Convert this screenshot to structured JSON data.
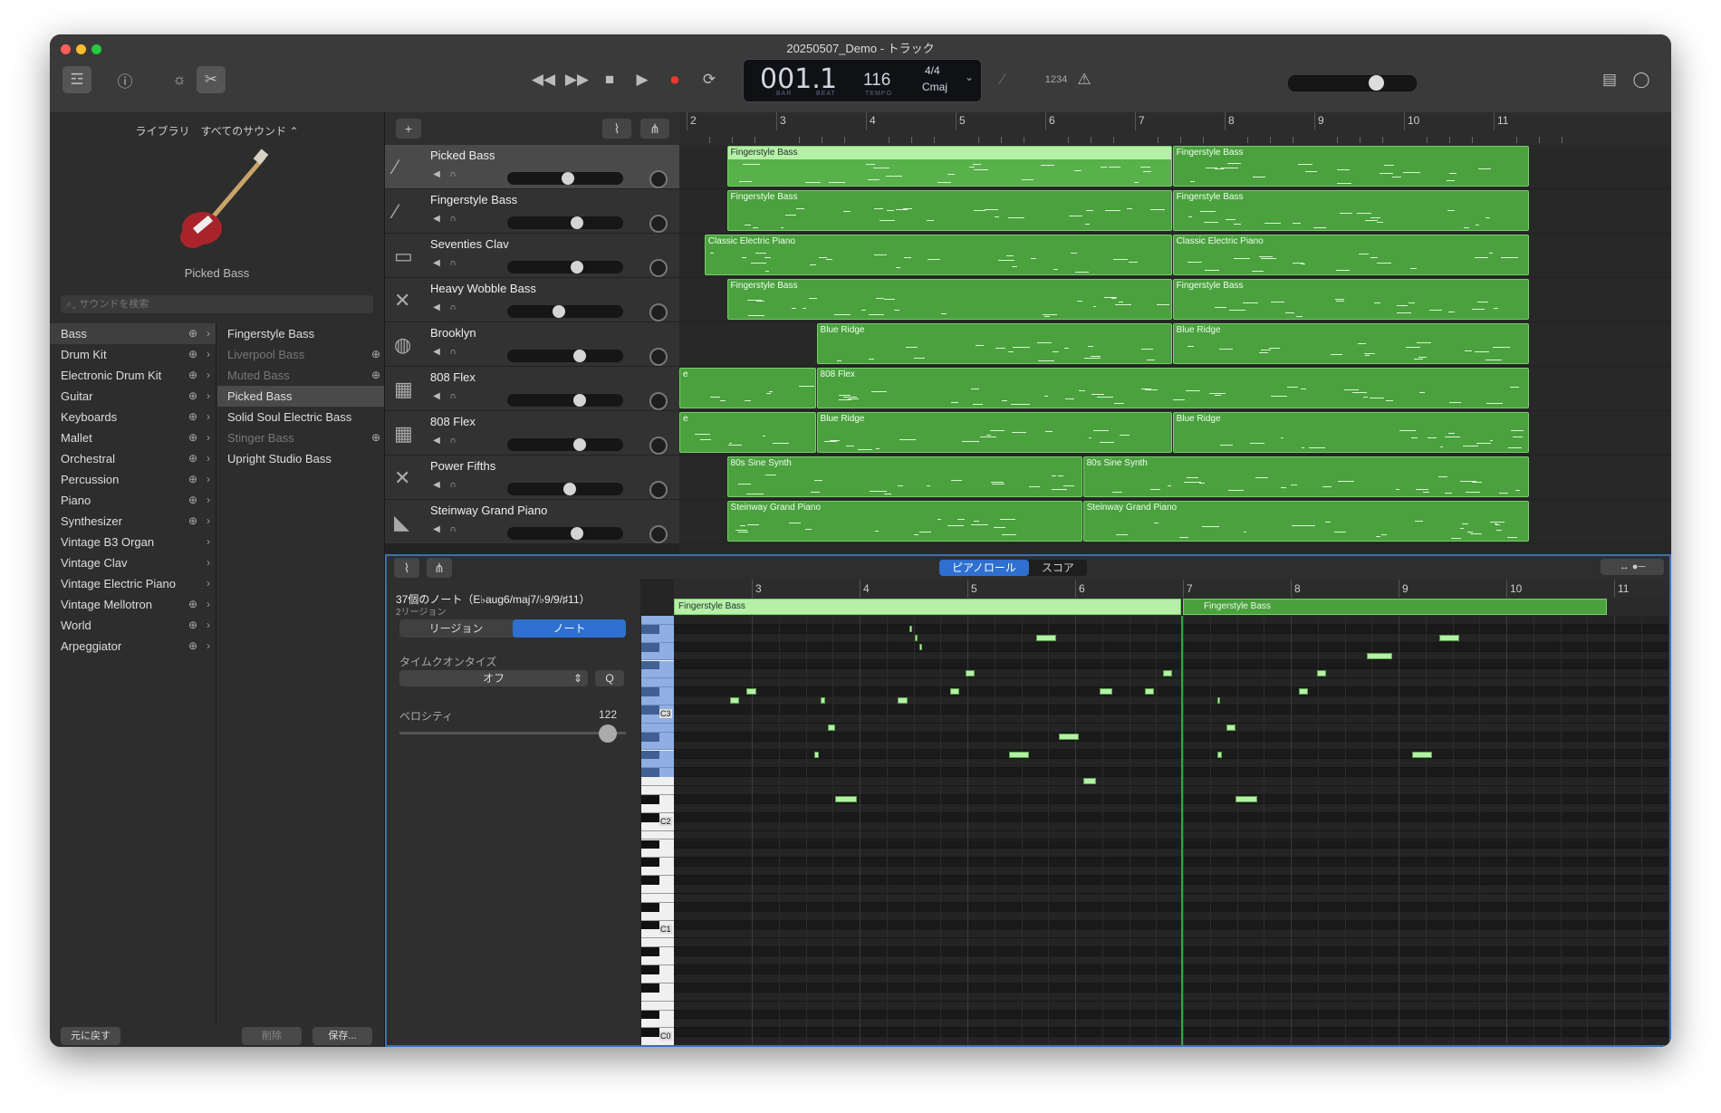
{
  "window": {
    "title": "20250507_Demo - トラック"
  },
  "transport": {
    "bar": "001.",
    "beat": "1",
    "bar_label": "BAR",
    "beat_label": "BEAT",
    "tempo": "116",
    "tempo_label": "TEMPO",
    "signature": "4/4",
    "key": "Cmaj",
    "count_in": "1234"
  },
  "library": {
    "header": "ライブラリ　すべてのサウンド ⌃",
    "selected_patch": "Picked Bass",
    "search_placeholder": "サウンドを検索",
    "categories": [
      "Bass",
      "Drum Kit",
      "Electronic Drum Kit",
      "Guitar",
      "Keyboards",
      "Mallet",
      "Orchestral",
      "Percussion",
      "Piano",
      "Synthesizer",
      "Vintage B3 Organ",
      "Vintage Clav",
      "Vintage Electric Piano",
      "Vintage Mellotron",
      "World",
      "Arpeggiator"
    ],
    "sounds": [
      "Fingerstyle Bass",
      "Liverpool Bass",
      "Muted Bass",
      "Picked Bass",
      "Solid Soul Electric Bass",
      "Stinger Bass",
      "Upright Studio Bass"
    ],
    "revert": "元に戻す",
    "delete": "削除",
    "save": "保存..."
  },
  "tracks": [
    {
      "name": "Picked Bass"
    },
    {
      "name": "Fingerstyle Bass"
    },
    {
      "name": "Seventies Clav"
    },
    {
      "name": "Heavy Wobble Bass"
    },
    {
      "name": "Brooklyn"
    },
    {
      "name": "808 Flex"
    },
    {
      "name": "808 Flex"
    },
    {
      "name": "Power Fifths"
    },
    {
      "name": "Steinway Grand Piano"
    }
  ],
  "ruler": [
    "2",
    "3",
    "4",
    "5",
    "6",
    "7",
    "8",
    "9",
    "10",
    "11"
  ],
  "regions": [
    [
      "Fingerstyle Bass",
      "Fingerstyle Bass"
    ],
    [
      "Fingerstyle Bass",
      "Fingerstyle Bass"
    ],
    [
      "Classic Electric Piano",
      "Classic Electric Piano"
    ],
    [
      "Fingerstyle Bass",
      "Fingerstyle Bass"
    ],
    [
      "Blue Ridge",
      "Blue Ridge"
    ],
    [
      "e",
      "808 Flex"
    ],
    [
      "e",
      "Blue Ridge",
      "Blue Ridge"
    ],
    [
      "80s Sine Synth",
      "80s Sine Synth"
    ],
    [
      "Steinway Grand Piano",
      "Steinway Grand Piano"
    ]
  ],
  "piano_roll": {
    "tab_pianoroll": "ピアノロール",
    "tab_score": "スコア",
    "note_info": "37個のノート（E♭aug6/maj7/♭9/9/♯11）",
    "region_count": "2リージョン",
    "tab_region": "リージョン",
    "tab_note": "ノート",
    "quantize_label": "タイムクオンタイズ",
    "quantize_value": "オフ",
    "q_button": "Q",
    "velocity_label": "ベロシティ",
    "velocity_value": "122",
    "ruler": [
      "3",
      "4",
      "5",
      "6",
      "7",
      "8",
      "9",
      "10",
      "11"
    ],
    "region_names": [
      "Fingerstyle Bass",
      "Fingerstyle Bass"
    ],
    "octaves": [
      "C3",
      "C2",
      "C1",
      "C0"
    ]
  },
  "colors": {
    "region": "#4aa13e",
    "accent": "#2e6fd0",
    "note": "#b6f0a6"
  }
}
